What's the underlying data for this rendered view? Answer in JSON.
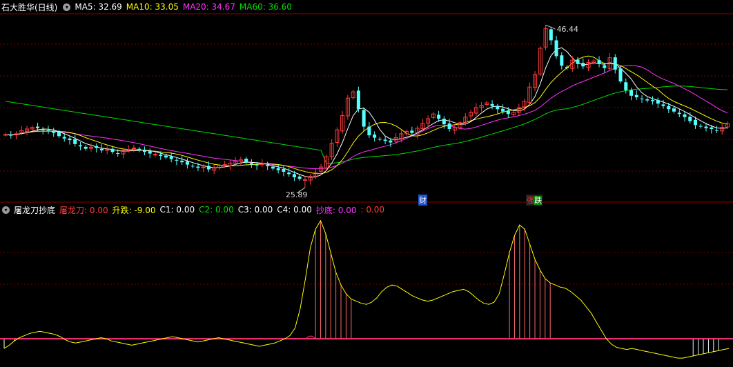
{
  "price_panel": {
    "title": "石大胜华(日线)",
    "ma5": "MA5: 32.69",
    "ma10": "MA10: 33.05",
    "ma20": "MA20: 34.67",
    "ma60": "MA60: 36.60",
    "high_label": "46.44",
    "low_label": "25.89",
    "event_fin": "财",
    "event_div": "强",
    "event_div2": "跌"
  },
  "indicator_panel": {
    "title": "屠龙刀抄底",
    "tulongdao": "屠龙刀: 0.00",
    "shengdie": "升跌: -9.00",
    "c1": "C1: 0.00",
    "c2": "C2: 0.00",
    "c3": "C3: 0.00",
    "c4": "C4: 0.00",
    "chaodi": "抄底: 0.00",
    "extra": ": 0.00"
  },
  "colors": {
    "up": "#ff3c3c",
    "down": "#54ffff",
    "ma5": "#ffffff",
    "ma10": "#ffff00",
    "ma20": "#ff33ff",
    "ma60": "#00dd00",
    "grid": "#7a0000",
    "baseline": "#ff3377"
  },
  "chart_data": [
    {
      "type": "candlestick",
      "title": "石大胜华(日线)",
      "ylim": [
        24.5,
        47.5
      ],
      "annotations": {
        "max": 46.44,
        "min": 25.89
      },
      "series": [
        {
          "name": "MA5",
          "last": 32.69
        },
        {
          "name": "MA10",
          "last": 33.05
        },
        {
          "name": "MA20",
          "last": 34.67
        },
        {
          "name": "MA60",
          "last": 36.6
        }
      ],
      "closes": [
        32.6,
        32.5,
        32.7,
        33.1,
        33.3,
        33.5,
        33.4,
        33.2,
        33.0,
        32.8,
        32.4,
        32.1,
        31.9,
        31.4,
        31.1,
        30.8,
        31.0,
        30.9,
        30.6,
        30.7,
        30.4,
        30.2,
        30.6,
        30.7,
        30.9,
        30.6,
        30.4,
        30.2,
        30.1,
        29.9,
        29.7,
        29.5,
        29.3,
        29.1,
        28.8,
        28.6,
        28.4,
        28.5,
        28.2,
        28.4,
        28.7,
        28.8,
        29.0,
        29.2,
        29.4,
        29.1,
        28.8,
        28.7,
        28.9,
        28.6,
        28.3,
        28.1,
        27.9,
        27.6,
        27.2,
        27.0,
        26.9,
        27.3,
        27.8,
        28.5,
        29.8,
        31.5,
        33.2,
        35.0,
        37.2,
        38.0,
        35.8,
        33.6,
        32.5,
        32.2,
        32.0,
        31.8,
        31.6,
        32.2,
        32.7,
        33.0,
        32.8,
        33.4,
        34.0,
        34.6,
        35.2,
        34.6,
        33.9,
        33.3,
        33.5,
        34.1,
        34.8,
        35.4,
        36.0,
        36.3,
        36.6,
        36.2,
        35.8,
        35.5,
        35.2,
        35.4,
        36.0,
        36.8,
        38.6,
        40.2,
        43.5,
        46.0,
        44.5,
        42.5,
        41.3,
        41.0,
        42.0,
        41.5,
        41.2,
        41.7,
        41.9,
        41.5,
        41.0,
        42.3,
        40.8,
        39.3,
        38.2,
        37.5,
        37.3,
        37.1,
        36.9,
        36.8,
        36.5,
        36.2,
        35.8,
        35.5,
        35.2,
        34.8,
        34.3,
        33.8,
        33.6,
        33.4,
        33.3,
        33.1,
        33.5,
        34.0
      ],
      "highs_extra": {
        "idx": 101,
        "high": 46.44
      },
      "lows_extra": {
        "idx": 56,
        "low": 25.89
      }
    },
    {
      "type": "line",
      "title": "屠龙刀抄底",
      "series": [
        {
          "name": "升跌",
          "values": [
            -9,
            -6,
            -2,
            1,
            3,
            5,
            6,
            7,
            6,
            5,
            4,
            2,
            -1,
            -3,
            -4,
            -3,
            -2,
            -1,
            0,
            1,
            0,
            -2,
            -3,
            -4,
            -5,
            -6,
            -5,
            -4,
            -3,
            -2,
            -1,
            0,
            1,
            2,
            1,
            0,
            -1,
            -2,
            -3,
            -2,
            -1,
            0,
            1,
            0,
            -1,
            -2,
            -3,
            -4,
            -5,
            -6,
            -7,
            -6,
            -5,
            -4,
            -2,
            0,
            3,
            10,
            28,
            55,
            85,
            102,
            110,
            98,
            80,
            62,
            50,
            42,
            37,
            35,
            33,
            32,
            34,
            38,
            44,
            48,
            50,
            49,
            46,
            43,
            40,
            38,
            36,
            35,
            36,
            38,
            40,
            42,
            44,
            45,
            46,
            44,
            40,
            36,
            33,
            32,
            34,
            42,
            60,
            80,
            96,
            106,
            102,
            88,
            74,
            64,
            56,
            52,
            50,
            48,
            47,
            44,
            40,
            36,
            30,
            24,
            16,
            8,
            0,
            -5,
            -8,
            -9,
            -10,
            -9,
            -10,
            -11,
            -12,
            -13,
            -14,
            -15,
            -16,
            -17,
            -18,
            -18,
            -17,
            -16,
            -15,
            -14,
            -13,
            -12,
            -11,
            -10,
            -9
          ]
        }
      ],
      "baseline": 0
    }
  ]
}
